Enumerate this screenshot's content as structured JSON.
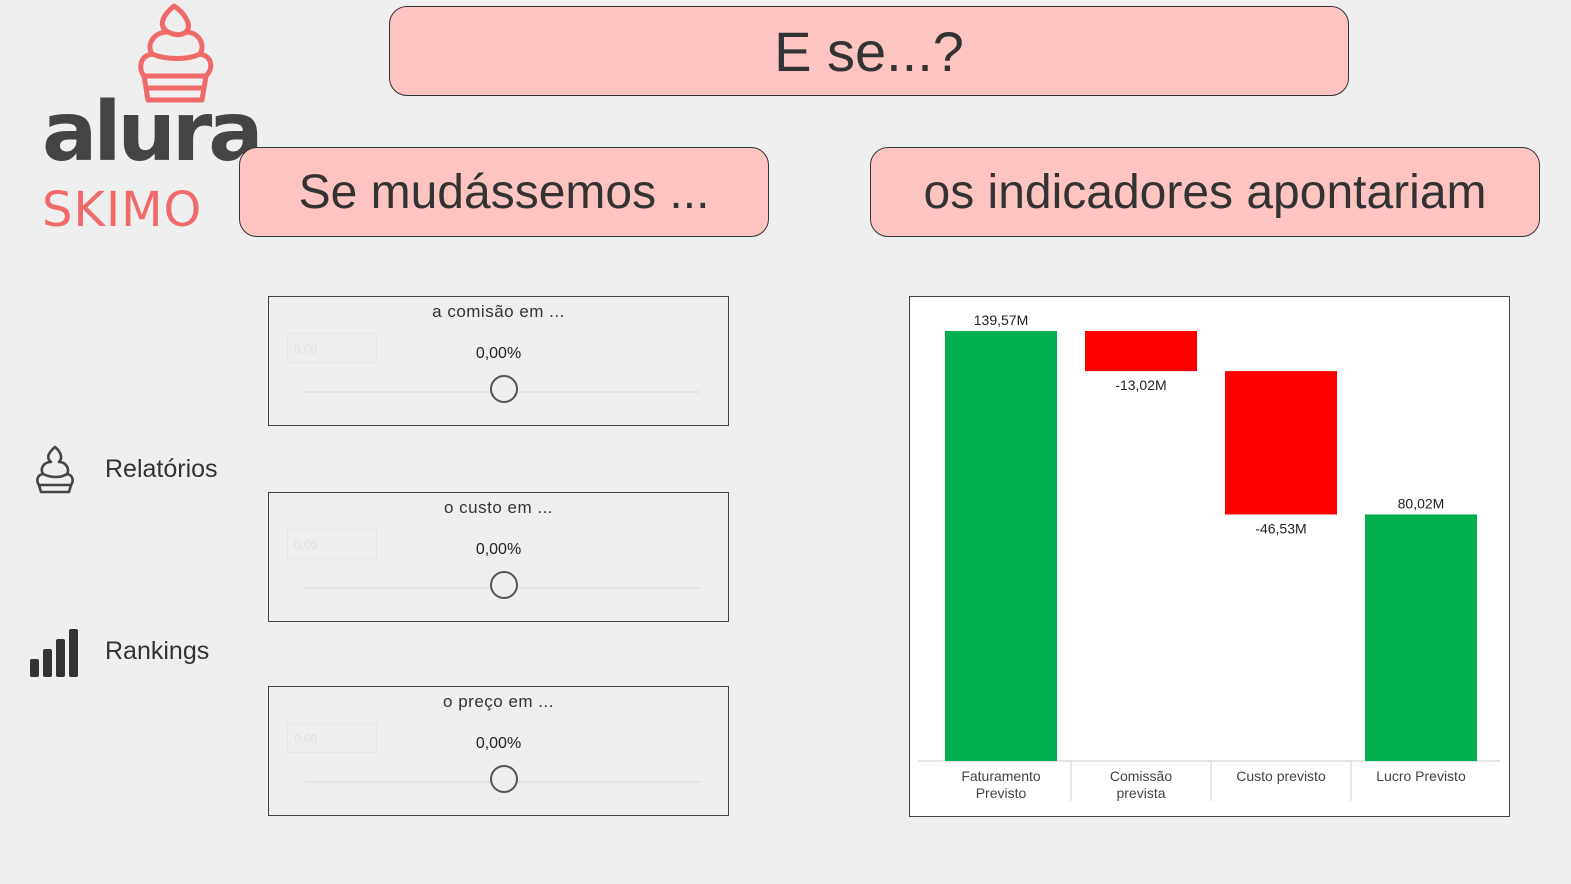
{
  "header": {
    "title": "E se...?"
  },
  "left_panel": {
    "title": "Se mudássemos ..."
  },
  "right_panel": {
    "title": "os indicadores apontariam"
  },
  "logo": {
    "word1": "alura",
    "word2": "SKIMO",
    "brand_color": "#f06a6a",
    "text_color": "#444444"
  },
  "nav": [
    {
      "label": "Relatórios",
      "icon": "ice-cream-icon"
    },
    {
      "label": "Rankings",
      "icon": "bar-chart-icon"
    }
  ],
  "slicers": [
    {
      "title": "a comisão em ...",
      "value": "0,00%",
      "ghost": "0,00",
      "level": 0.5
    },
    {
      "title": "o custo em ...",
      "value": "0,00%",
      "ghost": "0,00",
      "level": 0.5
    },
    {
      "title": "o preço em ...",
      "value": "0,00%",
      "ghost": "0,00",
      "level": 0.5
    }
  ],
  "colors": {
    "pill_bg": "#fec4c2",
    "increase": "#00b050",
    "decrease": "#ff0000"
  },
  "chart_data": {
    "type": "bar",
    "subtype": "waterfall",
    "categories": [
      "Faturamento Previsto",
      "Comissão prevista",
      "Custo previsto",
      "Lucro Previsto"
    ],
    "category_lines": [
      [
        "Faturamento",
        "Previsto"
      ],
      [
        "Comissão",
        "prevista"
      ],
      [
        "Custo previsto"
      ],
      [
        "Lucro Previsto"
      ]
    ],
    "values": [
      139.57,
      -13.02,
      -46.53,
      80.02
    ],
    "kinds": [
      "total",
      "delta",
      "delta",
      "total"
    ],
    "data_labels": [
      "139,57M",
      "-13,02M",
      "-46,53M",
      "80,02M"
    ],
    "ylim": [
      0,
      139.57
    ],
    "grid": false
  }
}
